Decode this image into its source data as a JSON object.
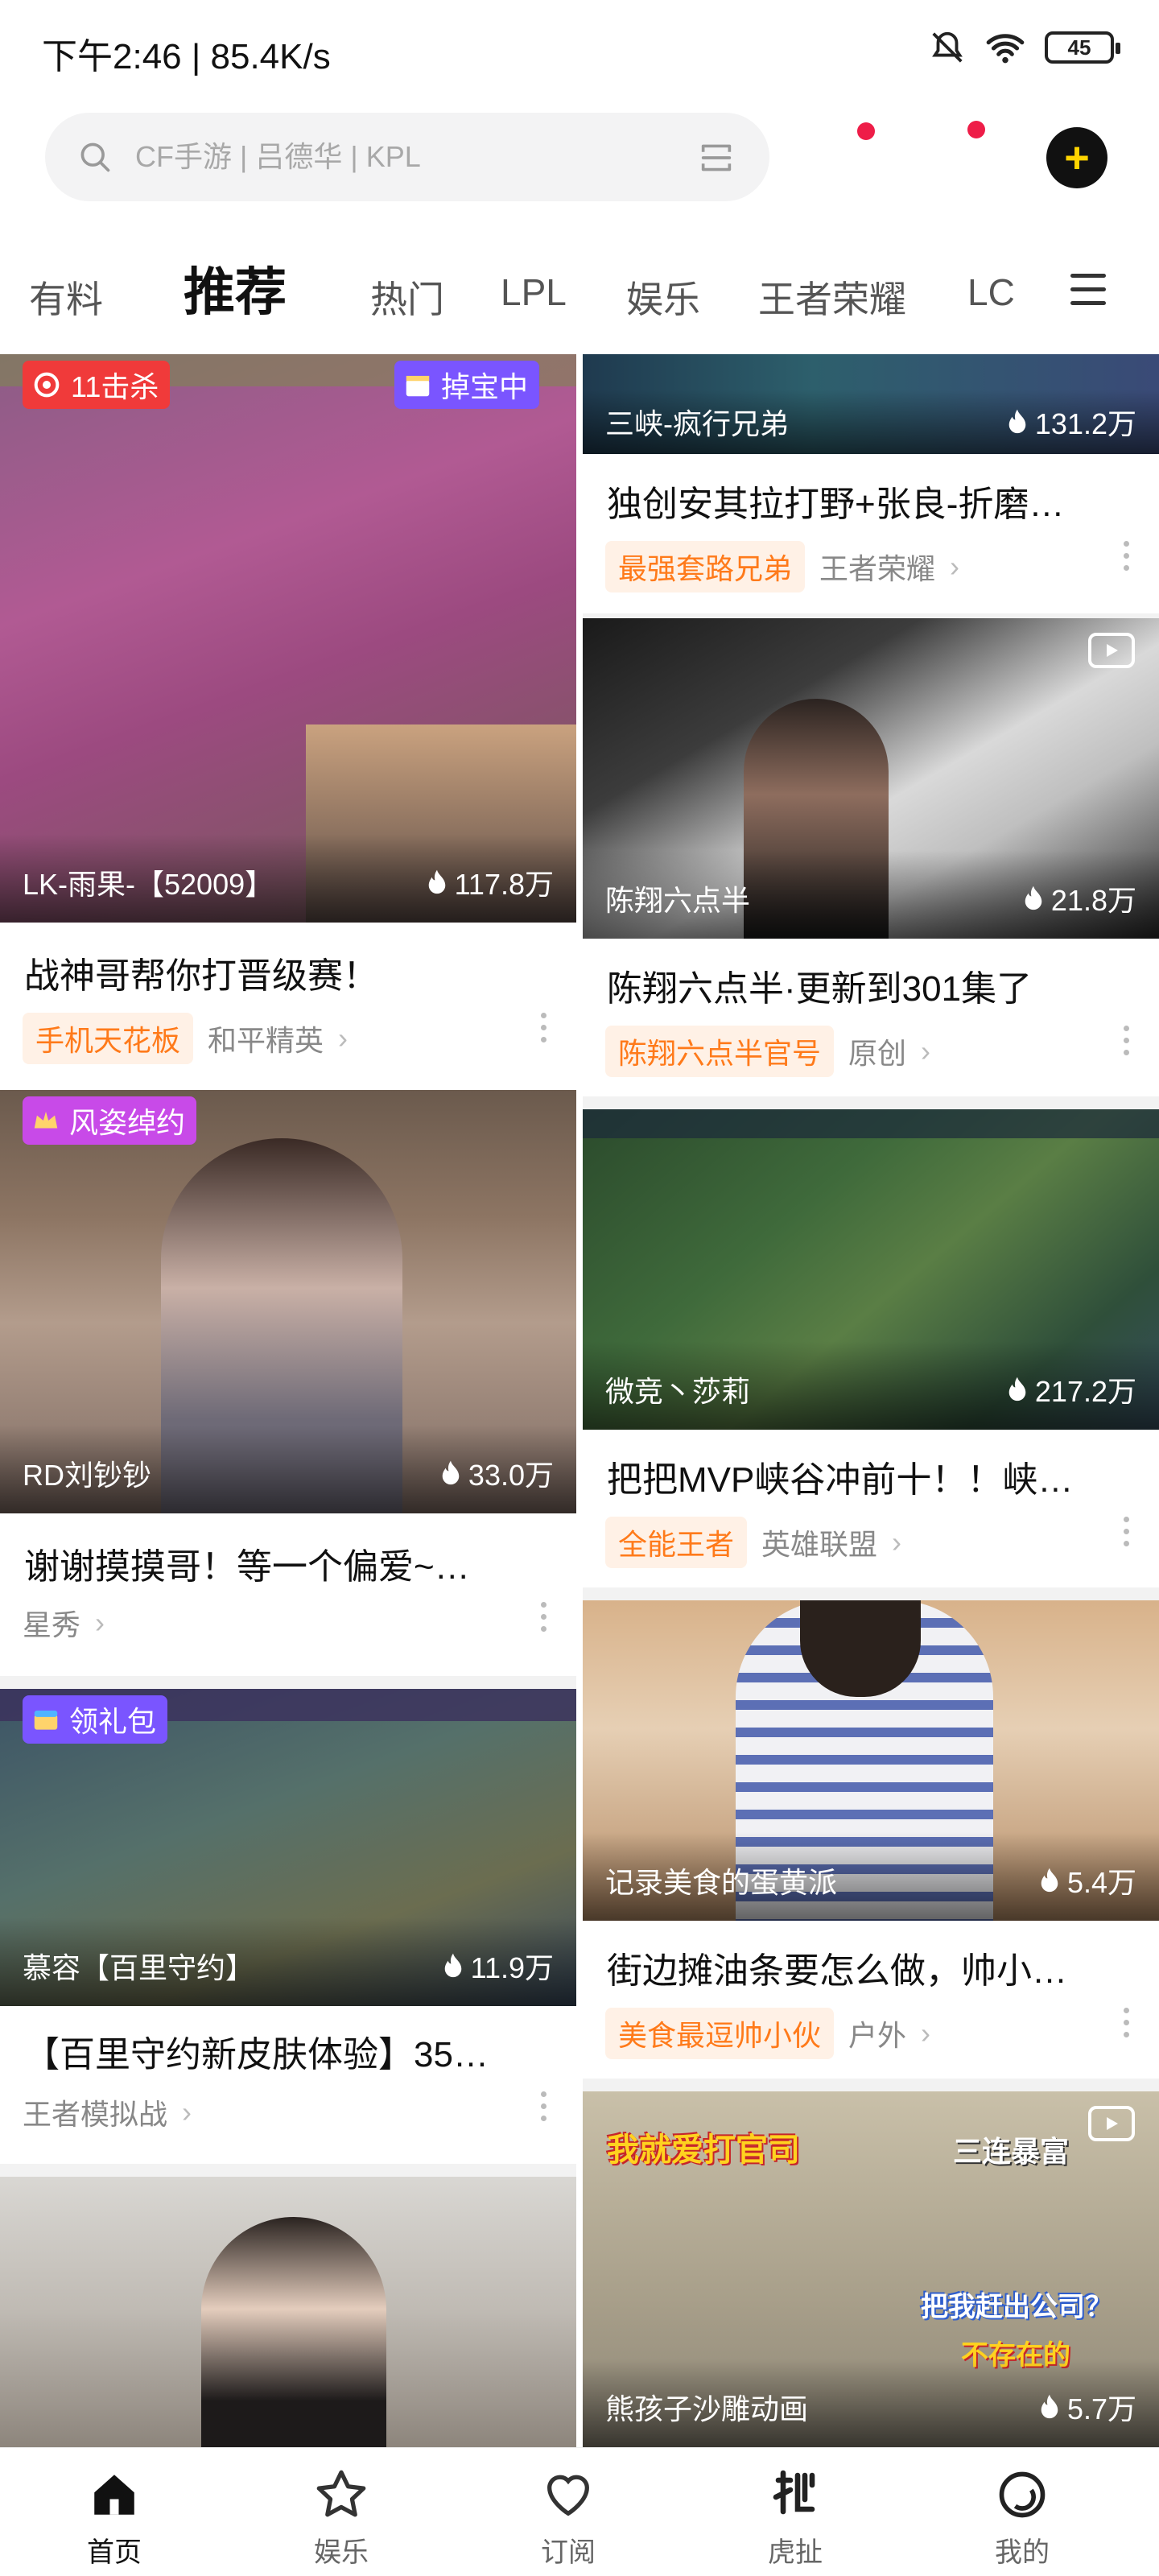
{
  "status": {
    "time": "下午2:46 | 85.4K/s",
    "battery": "45"
  },
  "search": {
    "placeholder": "CF手游 | 吕德华 | KPL"
  },
  "colors": {
    "accent": "#ff7a1a",
    "red_dot": "#ee1d48",
    "plus_icon": "#ffd400"
  },
  "tabs": [
    {
      "label": "有料"
    },
    {
      "label": "推荐",
      "active": true
    },
    {
      "label": "热门"
    },
    {
      "label": "LPL"
    },
    {
      "label": "娱乐"
    },
    {
      "label": "王者荣耀"
    },
    {
      "label": "LC"
    }
  ],
  "left_feed": [
    {
      "badge": "11击杀",
      "badge2": "掉宝中",
      "streamer": "LK-雨果-【52009】",
      "heat": "117.8万",
      "title": "战神哥帮你打晋级赛！",
      "tag": "手机天花板",
      "category": "和平精英"
    },
    {
      "badge": "风姿绰约",
      "streamer": "RD刘钞钞",
      "heat": "33.0万",
      "title": "谢谢摸摸哥！等一个偏爱~…",
      "category": "星秀"
    },
    {
      "badge": "领礼包",
      "streamer": "慕容【百里守约】",
      "heat": "11.9万",
      "title": "【百里守约新皮肤体验】35…",
      "category": "王者模拟战"
    }
  ],
  "right_feed": [
    {
      "streamer": "三峡-疯行兄弟",
      "heat": "131.2万",
      "title": "独创安其拉打野+张良-折磨…",
      "tag": "最强套路兄弟",
      "category": "王者荣耀"
    },
    {
      "streamer": "陈翔六点半",
      "heat": "21.8万",
      "title": "陈翔六点半·更新到301集了",
      "tag": "陈翔六点半官号",
      "category": "原创"
    },
    {
      "streamer": "微竞丶莎莉",
      "heat": "217.2万",
      "title": "把把MVP峡谷冲前十！！峡…",
      "tag": "全能王者",
      "category": "英雄联盟"
    },
    {
      "streamer": "记录美食的蛋黄派",
      "heat": "5.4万",
      "title": "街边摊油条要怎么做，帅小…",
      "tag": "美食最逗帅小伙",
      "category": "户外"
    },
    {
      "streamer": "熊孩子沙雕动画",
      "heat": "5.7万",
      "thumb_text": "我就爱打官司",
      "thumb_text2": "三连暴富",
      "thumb_text3": "把我赶出公司？",
      "thumb_text4": "不存在的"
    }
  ],
  "nav": [
    {
      "label": "首页",
      "icon": "home-icon"
    },
    {
      "label": "娱乐",
      "icon": "star-icon"
    },
    {
      "label": "订阅",
      "icon": "heart-icon"
    },
    {
      "label": "虎扯",
      "icon": "huche-icon"
    },
    {
      "label": "我的",
      "icon": "profile-icon"
    }
  ]
}
